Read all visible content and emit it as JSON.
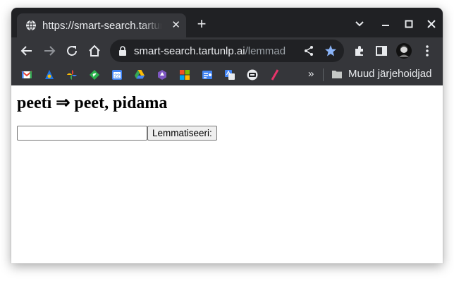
{
  "tab": {
    "title": "https://smart-search.tartunlp.ai/lemmad",
    "close_glyph": "✕"
  },
  "new_tab_glyph": "+",
  "address_bar": {
    "host": "smart-search.tartunlp.ai",
    "path": "/lemmad"
  },
  "bookmarks": {
    "overflow_glyph": "»",
    "folder_label": "Muud järjehoidjad",
    "calendar_day": "22"
  },
  "page": {
    "heading": "peeti ⇒ peet, pidama",
    "input_value": "",
    "button_label": "Lemmatiseeri:"
  },
  "colors": {
    "tabstrip": "#202124",
    "toolbar": "#35363a",
    "text_light": "#e8eaed",
    "star_accent": "#8ab4f8"
  }
}
